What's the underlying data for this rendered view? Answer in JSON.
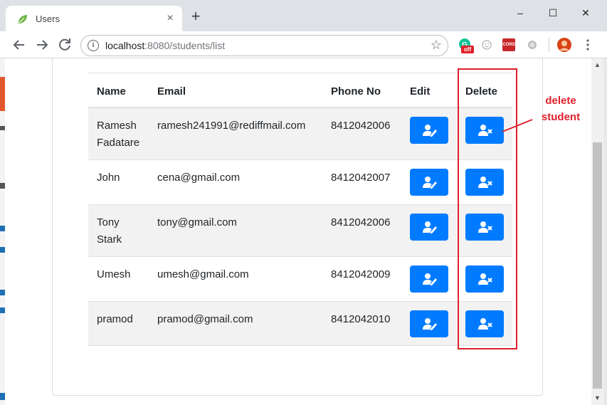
{
  "browser": {
    "tab_title": "Users",
    "tab_close": "×",
    "new_tab": "+",
    "window_controls": {
      "minimize": "–",
      "maximize": "☐",
      "close": "✕"
    },
    "url_host": "localhost",
    "url_rest": ":8080/students/list",
    "extensions": [
      "grammarly-icon",
      "emoji-icon",
      "cors-icon",
      "circle-icon",
      "profile-avatar"
    ],
    "grammarly_badge": "off",
    "cors_label": "CORS"
  },
  "table": {
    "headers": {
      "name": "Name",
      "email": "Email",
      "phone": "Phone No",
      "edit": "Edit",
      "delete": "Delete"
    },
    "rows": [
      {
        "name_line1": "Ramesh",
        "name_line2": "Fadatare",
        "email": "ramesh241991@rediffmail.com",
        "phone": "8412042006"
      },
      {
        "name_line1": "John",
        "name_line2": "",
        "email": "cena@gmail.com",
        "phone": "8412042007"
      },
      {
        "name_line1": "Tony",
        "name_line2": "Stark",
        "email": "tony@gmail.com",
        "phone": "8412042006"
      },
      {
        "name_line1": "Umesh",
        "name_line2": "",
        "email": "umesh@gmail.com",
        "phone": "8412042009"
      },
      {
        "name_line1": "pramod",
        "name_line2": "",
        "email": "pramod@gmail.com",
        "phone": "8412042010"
      }
    ]
  },
  "annotation": {
    "line1": "delete",
    "line2": "student"
  },
  "colors": {
    "primary": "#007bff",
    "annotation": "#e0202b",
    "stripe": "#f2f2f2"
  }
}
